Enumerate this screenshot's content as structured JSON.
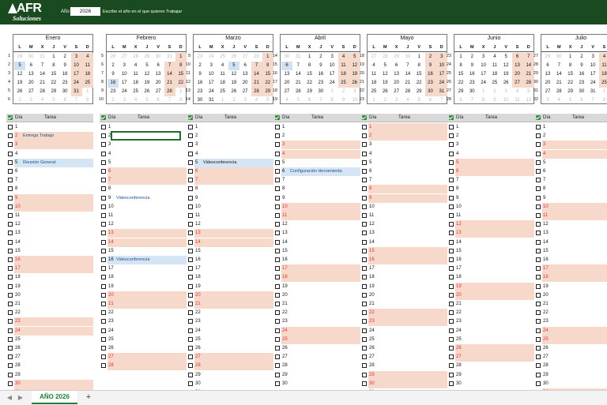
{
  "header": {
    "brand_main": "AFR",
    "brand_sub": "Soluciones",
    "year_label": "Año",
    "year_value": "2026",
    "year_hint": "Escribe el año en el que quieres Trabajar"
  },
  "weekdays": [
    "L",
    "M",
    "X",
    "J",
    "V",
    "S",
    "D"
  ],
  "months": [
    {
      "name": "Enero",
      "weeks": [
        1,
        2,
        3,
        4,
        5,
        6
      ],
      "days": [
        [
          29,
          true
        ],
        [
          30,
          true
        ],
        [
          31,
          true
        ],
        [
          1,
          false
        ],
        [
          2,
          false
        ],
        [
          3,
          false
        ],
        [
          4,
          false
        ],
        [
          5,
          false
        ],
        [
          6,
          false
        ],
        [
          7,
          false
        ],
        [
          8,
          false
        ],
        [
          9,
          false
        ],
        [
          10,
          false
        ],
        [
          11,
          false
        ],
        [
          12,
          false
        ],
        [
          13,
          false
        ],
        [
          14,
          false
        ],
        [
          15,
          false
        ],
        [
          16,
          false
        ],
        [
          17,
          false
        ],
        [
          18,
          false
        ],
        [
          19,
          false
        ],
        [
          20,
          false
        ],
        [
          21,
          false
        ],
        [
          22,
          false
        ],
        [
          23,
          false
        ],
        [
          24,
          false
        ],
        [
          25,
          false
        ],
        [
          26,
          false
        ],
        [
          27,
          false
        ],
        [
          28,
          false
        ],
        [
          29,
          false
        ],
        [
          30,
          false
        ],
        [
          31,
          false
        ],
        [
          1,
          true
        ],
        [
          2,
          true
        ],
        [
          3,
          true
        ],
        [
          4,
          true
        ],
        [
          5,
          true
        ],
        [
          6,
          true
        ],
        [
          7,
          true
        ],
        [
          8,
          true
        ]
      ]
    },
    {
      "name": "Febrero",
      "weeks": [
        5,
        6,
        7,
        8,
        9,
        10
      ],
      "days": [
        [
          26,
          true
        ],
        [
          27,
          true
        ],
        [
          28,
          true
        ],
        [
          29,
          true
        ],
        [
          30,
          true
        ],
        [
          31,
          true
        ],
        [
          1,
          false
        ],
        [
          2,
          false
        ],
        [
          3,
          false
        ],
        [
          4,
          false
        ],
        [
          5,
          false
        ],
        [
          6,
          false
        ],
        [
          7,
          false
        ],
        [
          8,
          false
        ],
        [
          9,
          false
        ],
        [
          10,
          false
        ],
        [
          11,
          false
        ],
        [
          12,
          false
        ],
        [
          13,
          false
        ],
        [
          14,
          false
        ],
        [
          15,
          false
        ],
        [
          16,
          false
        ],
        [
          17,
          false
        ],
        [
          18,
          false
        ],
        [
          19,
          false
        ],
        [
          20,
          false
        ],
        [
          21,
          false
        ],
        [
          22,
          false
        ],
        [
          23,
          false
        ],
        [
          24,
          false
        ],
        [
          25,
          false
        ],
        [
          26,
          false
        ],
        [
          27,
          false
        ],
        [
          28,
          false
        ],
        [
          1,
          true
        ],
        [
          2,
          true
        ],
        [
          3,
          true
        ],
        [
          4,
          true
        ],
        [
          5,
          true
        ],
        [
          6,
          true
        ],
        [
          7,
          true
        ],
        [
          8,
          true
        ]
      ]
    },
    {
      "name": "Marzo",
      "weeks": [
        9,
        10,
        11,
        12,
        13,
        14
      ],
      "days": [
        [
          23,
          true
        ],
        [
          24,
          true
        ],
        [
          25,
          true
        ],
        [
          26,
          true
        ],
        [
          27,
          true
        ],
        [
          28,
          true
        ],
        [
          1,
          false
        ],
        [
          2,
          false
        ],
        [
          3,
          false
        ],
        [
          4,
          false
        ],
        [
          5,
          false
        ],
        [
          6,
          false
        ],
        [
          7,
          false
        ],
        [
          8,
          false
        ],
        [
          9,
          false
        ],
        [
          10,
          false
        ],
        [
          11,
          false
        ],
        [
          12,
          false
        ],
        [
          13,
          false
        ],
        [
          14,
          false
        ],
        [
          15,
          false
        ],
        [
          16,
          false
        ],
        [
          17,
          false
        ],
        [
          18,
          false
        ],
        [
          19,
          false
        ],
        [
          20,
          false
        ],
        [
          21,
          false
        ],
        [
          22,
          false
        ],
        [
          23,
          false
        ],
        [
          24,
          false
        ],
        [
          25,
          false
        ],
        [
          26,
          false
        ],
        [
          27,
          false
        ],
        [
          28,
          false
        ],
        [
          29,
          false
        ],
        [
          30,
          false
        ],
        [
          31,
          false
        ],
        [
          1,
          true
        ],
        [
          2,
          true
        ],
        [
          3,
          true
        ],
        [
          4,
          true
        ],
        [
          5,
          true
        ]
      ]
    },
    {
      "name": "Abril",
      "weeks": [
        14,
        15,
        16,
        17,
        18,
        19
      ],
      "days": [
        [
          30,
          true
        ],
        [
          31,
          true
        ],
        [
          1,
          false
        ],
        [
          2,
          false
        ],
        [
          3,
          false
        ],
        [
          4,
          false
        ],
        [
          5,
          false
        ],
        [
          6,
          false
        ],
        [
          7,
          false
        ],
        [
          8,
          false
        ],
        [
          9,
          false
        ],
        [
          10,
          false
        ],
        [
          11,
          false
        ],
        [
          12,
          false
        ],
        [
          13,
          false
        ],
        [
          14,
          false
        ],
        [
          15,
          false
        ],
        [
          16,
          false
        ],
        [
          17,
          false
        ],
        [
          18,
          false
        ],
        [
          19,
          false
        ],
        [
          20,
          false
        ],
        [
          21,
          false
        ],
        [
          22,
          false
        ],
        [
          23,
          false
        ],
        [
          24,
          false
        ],
        [
          25,
          false
        ],
        [
          26,
          false
        ],
        [
          27,
          false
        ],
        [
          28,
          false
        ],
        [
          29,
          false
        ],
        [
          30,
          false
        ],
        [
          1,
          true
        ],
        [
          2,
          true
        ],
        [
          3,
          true
        ],
        [
          4,
          true
        ],
        [
          5,
          true
        ],
        [
          6,
          true
        ],
        [
          7,
          true
        ],
        [
          8,
          true
        ],
        [
          9,
          true
        ],
        [
          10,
          true
        ]
      ]
    },
    {
      "name": "Mayo",
      "weeks": [
        18,
        19,
        20,
        21,
        22,
        23
      ],
      "days": [
        [
          27,
          true
        ],
        [
          28,
          true
        ],
        [
          29,
          true
        ],
        [
          30,
          true
        ],
        [
          1,
          false
        ],
        [
          2,
          false
        ],
        [
          3,
          false
        ],
        [
          4,
          false
        ],
        [
          5,
          false
        ],
        [
          6,
          false
        ],
        [
          7,
          false
        ],
        [
          8,
          false
        ],
        [
          9,
          false
        ],
        [
          10,
          false
        ],
        [
          11,
          false
        ],
        [
          12,
          false
        ],
        [
          13,
          false
        ],
        [
          14,
          false
        ],
        [
          15,
          false
        ],
        [
          16,
          false
        ],
        [
          17,
          false
        ],
        [
          18,
          false
        ],
        [
          19,
          false
        ],
        [
          20,
          false
        ],
        [
          21,
          false
        ],
        [
          22,
          false
        ],
        [
          23,
          false
        ],
        [
          24,
          false
        ],
        [
          25,
          false
        ],
        [
          26,
          false
        ],
        [
          27,
          false
        ],
        [
          28,
          false
        ],
        [
          29,
          false
        ],
        [
          30,
          false
        ],
        [
          31,
          false
        ],
        [
          1,
          true
        ],
        [
          2,
          true
        ],
        [
          3,
          true
        ],
        [
          4,
          true
        ],
        [
          5,
          true
        ],
        [
          6,
          true
        ],
        [
          7,
          true
        ]
      ]
    },
    {
      "name": "Junio",
      "weeks": [
        23,
        24,
        25,
        26,
        27,
        28
      ],
      "days": [
        [
          1,
          false
        ],
        [
          2,
          false
        ],
        [
          3,
          false
        ],
        [
          4,
          false
        ],
        [
          5,
          false
        ],
        [
          6,
          false
        ],
        [
          7,
          false
        ],
        [
          8,
          false
        ],
        [
          9,
          false
        ],
        [
          10,
          false
        ],
        [
          11,
          false
        ],
        [
          12,
          false
        ],
        [
          13,
          false
        ],
        [
          14,
          false
        ],
        [
          15,
          false
        ],
        [
          16,
          false
        ],
        [
          17,
          false
        ],
        [
          18,
          false
        ],
        [
          19,
          false
        ],
        [
          20,
          false
        ],
        [
          21,
          false
        ],
        [
          22,
          false
        ],
        [
          23,
          false
        ],
        [
          24,
          false
        ],
        [
          25,
          false
        ],
        [
          26,
          false
        ],
        [
          27,
          false
        ],
        [
          28,
          false
        ],
        [
          29,
          false
        ],
        [
          30,
          false
        ],
        [
          1,
          true
        ],
        [
          2,
          true
        ],
        [
          3,
          true
        ],
        [
          4,
          true
        ],
        [
          5,
          true
        ],
        [
          6,
          true
        ],
        [
          7,
          true
        ],
        [
          8,
          true
        ],
        [
          9,
          true
        ],
        [
          10,
          true
        ],
        [
          11,
          true
        ],
        [
          12,
          true
        ]
      ]
    },
    {
      "name": "Julio",
      "weeks": [
        27,
        28,
        29,
        30,
        31,
        32
      ],
      "days": [
        [
          29,
          true
        ],
        [
          30,
          true
        ],
        [
          1,
          false
        ],
        [
          2,
          false
        ],
        [
          3,
          false
        ],
        [
          4,
          false
        ],
        [
          5,
          false
        ],
        [
          6,
          false
        ],
        [
          7,
          false
        ],
        [
          8,
          false
        ],
        [
          9,
          false
        ],
        [
          10,
          false
        ],
        [
          11,
          false
        ],
        [
          12,
          false
        ],
        [
          13,
          false
        ],
        [
          14,
          false
        ],
        [
          15,
          false
        ],
        [
          16,
          false
        ],
        [
          17,
          false
        ],
        [
          18,
          false
        ],
        [
          19,
          false
        ],
        [
          20,
          false
        ],
        [
          21,
          false
        ],
        [
          22,
          false
        ],
        [
          23,
          false
        ],
        [
          24,
          false
        ],
        [
          25,
          false
        ],
        [
          26,
          false
        ],
        [
          27,
          false
        ],
        [
          28,
          false
        ],
        [
          29,
          false
        ],
        [
          30,
          false
        ],
        [
          31,
          false
        ],
        [
          1,
          true
        ],
        [
          2,
          true
        ],
        [
          3,
          true
        ],
        [
          4,
          true
        ],
        [
          5,
          true
        ],
        [
          6,
          true
        ],
        [
          7,
          true
        ],
        [
          8,
          true
        ],
        [
          9,
          true
        ]
      ]
    }
  ],
  "list_headers": {
    "dia": "Día",
    "tarea": "Tarea"
  },
  "events": {
    "0": {
      "2": "Entrega Trabajo",
      "5": "Reunión General"
    },
    "1": {
      "9": "Videoconferencia",
      "16": "Videoconferencia"
    },
    "2": {
      "5": "Videoconferencia"
    },
    "3": {
      "6": "Configuración Herramienta"
    }
  },
  "sheet_tab": "AÑO 2026",
  "add_sheet": "+",
  "nav_prev": "◀",
  "nav_next": "▶"
}
